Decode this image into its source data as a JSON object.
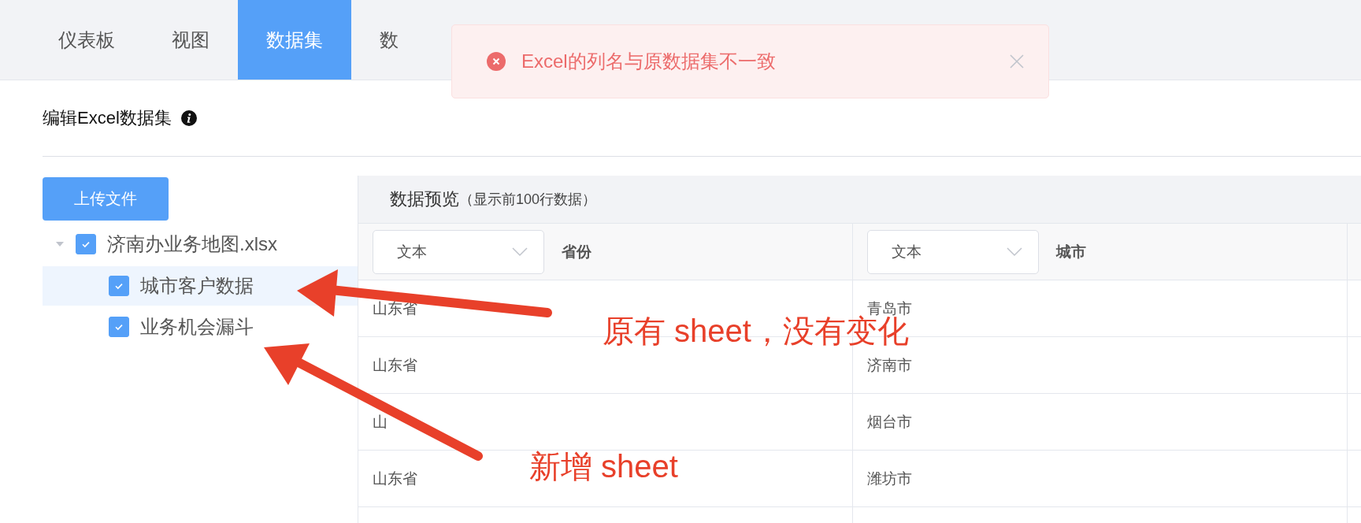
{
  "tabs": [
    {
      "label": "仪表板",
      "selected": false
    },
    {
      "label": "视图",
      "selected": false
    },
    {
      "label": "数据集",
      "selected": true
    },
    {
      "label": "数",
      "selected": false
    }
  ],
  "toast": {
    "kind": "error",
    "message": "Excel的列名与原数据集不一致"
  },
  "page_title": "编辑Excel数据集",
  "upload_button": "上传文件",
  "tree": [
    {
      "label": "济南办业务地图.xlsx",
      "checked": true,
      "expanded": true,
      "selected": false,
      "children": [
        {
          "label": "城市客户数据",
          "checked": true,
          "selected": true
        },
        {
          "label": "业务机会漏斗",
          "checked": true,
          "selected": false
        }
      ]
    }
  ],
  "preview": {
    "title": "数据预览",
    "note": "（显示前100行数据）",
    "columns": [
      {
        "type": "文本",
        "name": "省份"
      },
      {
        "type": "文本",
        "name": "城市"
      }
    ],
    "rows": [
      [
        "山东省",
        "青岛市"
      ],
      [
        "山东省",
        "济南市"
      ],
      [
        "山",
        "烟台市"
      ],
      [
        "山东省",
        "潍坊市"
      ]
    ]
  },
  "annotations": [
    {
      "text": "原有 sheet，没有变化"
    },
    {
      "text": "新增 sheet"
    }
  ]
}
